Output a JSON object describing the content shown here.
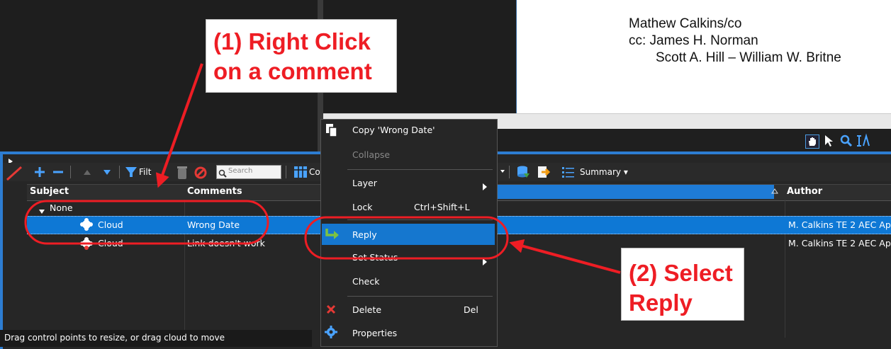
{
  "document": {
    "lines": [
      "Mathew Calkins/co",
      "cc:  James H. Norman",
      "Scott A. Hill – William W. Britne"
    ]
  },
  "toolbar": {
    "filter_label": "Filt",
    "columns_label": "Co",
    "search_placeholder": "Search",
    "summary_label": "Summary",
    "summary_chevron": "▾"
  },
  "table": {
    "headers": {
      "subject": "Subject",
      "comments": "Comments",
      "author": "Author"
    },
    "group": {
      "label": "None"
    },
    "rows": [
      {
        "subject": "Cloud",
        "comment": "Wrong Date",
        "author": "M. Calkins TE 2 AEC Ap"
      },
      {
        "subject": "Cloud",
        "comment": "Link doesn't work",
        "author": "M. Calkins TE 2 AEC Ap"
      }
    ]
  },
  "status_bar": {
    "text": "Drag control points to resize, or drag cloud to move"
  },
  "context_menu": {
    "items": [
      {
        "label": "Copy 'Wrong Date'",
        "icon": "copy-icon"
      },
      {
        "label": "Collapse"
      },
      {
        "label": "Layer",
        "submenu": true
      },
      {
        "label": "Lock",
        "shortcut": "Ctrl+Shift+L"
      },
      {
        "label": "Reply",
        "icon": "reply-arrow-icon",
        "highlighted": true
      },
      {
        "label": "Set Status",
        "submenu": true
      },
      {
        "label": "Check"
      },
      {
        "label": "Delete",
        "shortcut": "Del",
        "icon": "delete-x-icon"
      },
      {
        "label": "Properties",
        "icon": "gear-icon"
      }
    ]
  },
  "callouts": {
    "step1_line1": "(1) Right Click",
    "step1_line2": "on a comment",
    "step2_line1": "(2) Select",
    "step2_line2": "Reply"
  },
  "colors": {
    "selection": "#0e78d5",
    "annotation_red": "#ee1d24",
    "accent_blue": "#2d7dd2"
  }
}
